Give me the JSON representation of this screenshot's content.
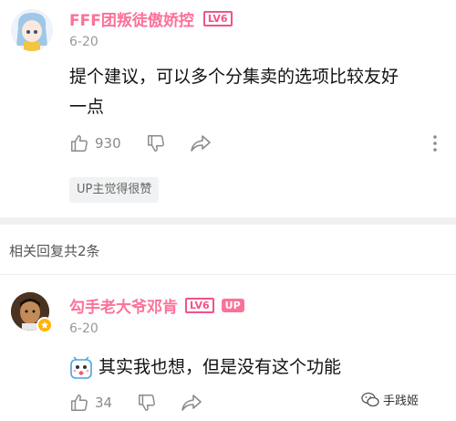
{
  "comment1": {
    "username": "FFF团叛徒傲娇控",
    "level": "LV6",
    "date": "6-20",
    "text_line1": "提个建议，可以多个分集卖的选项比较友好",
    "text_line2": "一点",
    "likes": "930",
    "up_tag": "UP主觉得很赞"
  },
  "replies_header": "相关回复共2条",
  "reply1": {
    "username": "勾手老大爷邓肯",
    "level": "LV6",
    "up_badge": "UP",
    "date": "6-20",
    "text": "其实我也想，但是没有这个功能",
    "likes": "34"
  },
  "watermark": "手践姬"
}
